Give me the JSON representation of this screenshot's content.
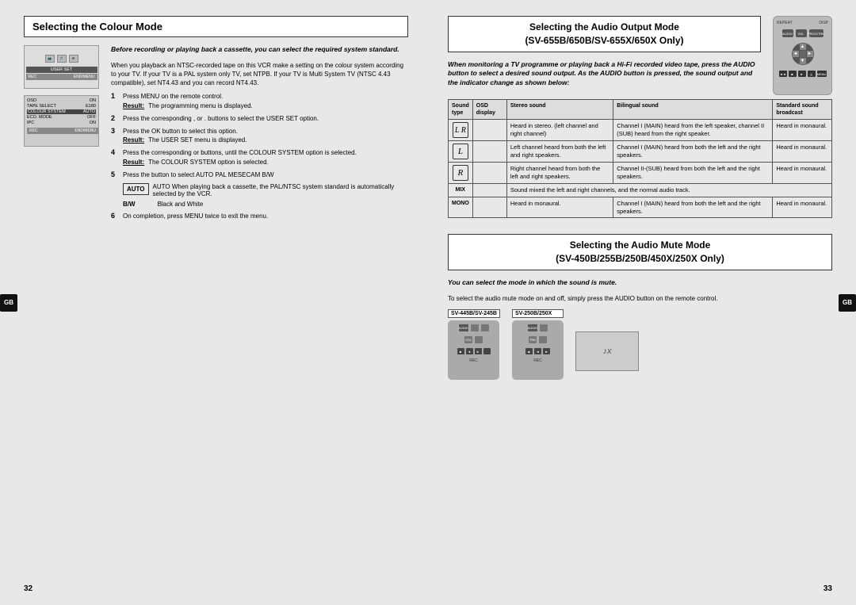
{
  "left_page": {
    "gb_badge": "GB",
    "section_title": "Selecting the Colour Mode",
    "intro_text": "Before recording or playing back a cassette, you can select the required system standard.",
    "body_text": "When you playback an NTSC-recorded tape on this VCR make a setting on the colour system according to your TV. If your TV is a PAL system only TV, set NTPB. If your TV is Multi System TV (NTSC 4.43 compatible), set NT4.43 and you can record NT4.43.",
    "steps": [
      {
        "num": "1",
        "text": "Press MENU on the remote control.",
        "result_label": "Result:",
        "result_text": "The programming menu is displayed."
      },
      {
        "num": "2",
        "text": "Press the corresponding  ,  or  .  buttons to select the USER SET option."
      },
      {
        "num": "3",
        "text": "Press the OK button to select this option.",
        "result_label": "Result:",
        "result_text": "The USER SET menu is displayed."
      },
      {
        "num": "4",
        "text": "Press the corresponding  or  buttons, until the COLOUR SYSTEM option is selected.",
        "result_label": "Result:",
        "result_text": "The COLOUR SYSTEM option is selected."
      },
      {
        "num": "5",
        "text": "Press the  button to select  AUTO  PAL  MESECAM  B/W"
      }
    ],
    "auto_note": "AUTO When playing back a cassette, the PAL/NTSC system standard is automatically selected by the VCR.",
    "bw_label": "B/W",
    "bw_text": "Black and White",
    "step6": {
      "num": "6",
      "text": "On completion, press MENU twice to exit the menu."
    },
    "user_set_label": "USER SET",
    "osd_label": "OSD",
    "osd_value": "ON",
    "tape_select_label": "TAPE SELECT",
    "tape_select_value": "E180",
    "colour_system_label": "COLOUR SYSTEM",
    "colour_system_value": "AUTO",
    "eco_mode_label": "ECO. MODE",
    "eco_mode_value": "OFF",
    "ipc_label": "IPC",
    "ipc_value": "ON",
    "page_number": "32"
  },
  "right_page": {
    "gb_badge": "GB",
    "audio_section": {
      "title_line1": "Selecting the Audio Output Mode",
      "title_line2": "(SV-655B/650B/SV-655X/650X Only)",
      "intro_text": "When monitoring a TV programme or playing back a Hi-Fi recorded video tape, press the AUDIO button to select a desired sound output. As the AUDIO button is pressed, the sound output and the indicator change as shown below:",
      "table_headers": {
        "col0": "Sound type",
        "col1": "Stereo sound",
        "col2": "Bilingual sound",
        "col3": "Standard sound broadcast"
      },
      "osd_label": "OSD display",
      "rows": [
        {
          "icon": "L R",
          "col1": "Heard in stereo. (left channel and right channel)",
          "col2": "Channel I (MAIN) heard from the left speaker, channel II (SUB) heard from the right speaker.",
          "col3": "Heard in monaural."
        },
        {
          "icon": "L",
          "col1": "Left channel heard from both the left and right speakers.",
          "col2": "Channel I (MAIN) heard from both the left and the right speakers.",
          "col3": "Heard in monaural."
        },
        {
          "icon": "R",
          "col1": "Right channel heard from both the left and right speakers.",
          "col2": "Channel II-(SUB) heard from both the left and the right speakers.",
          "col3": "Heard in monaural."
        },
        {
          "icon": "MIX",
          "col1": "Sound mixed the left and right channels, and the normal audio track.",
          "col2": "",
          "col3": ""
        },
        {
          "icon": "MONO",
          "col1": "Heard in monaural.",
          "col2": "Channel I (MAIN) heard from both the left and the right speakers.",
          "col3": "Heard in monaural."
        }
      ]
    },
    "mute_section": {
      "title_line1": "Selecting the Audio Mute Mode",
      "title_line2": "(SV-450B/255B/250B/450X/250X Only)",
      "intro_text": "You can select the mode in which the sound is mute.",
      "body_text": "To select the audio mute mode on and off, simply press the AUDIO button on the remote control.",
      "device1_label": "SV-445B/SV-245B",
      "device2_label": "SV-250B/250X"
    },
    "page_number": "33"
  }
}
